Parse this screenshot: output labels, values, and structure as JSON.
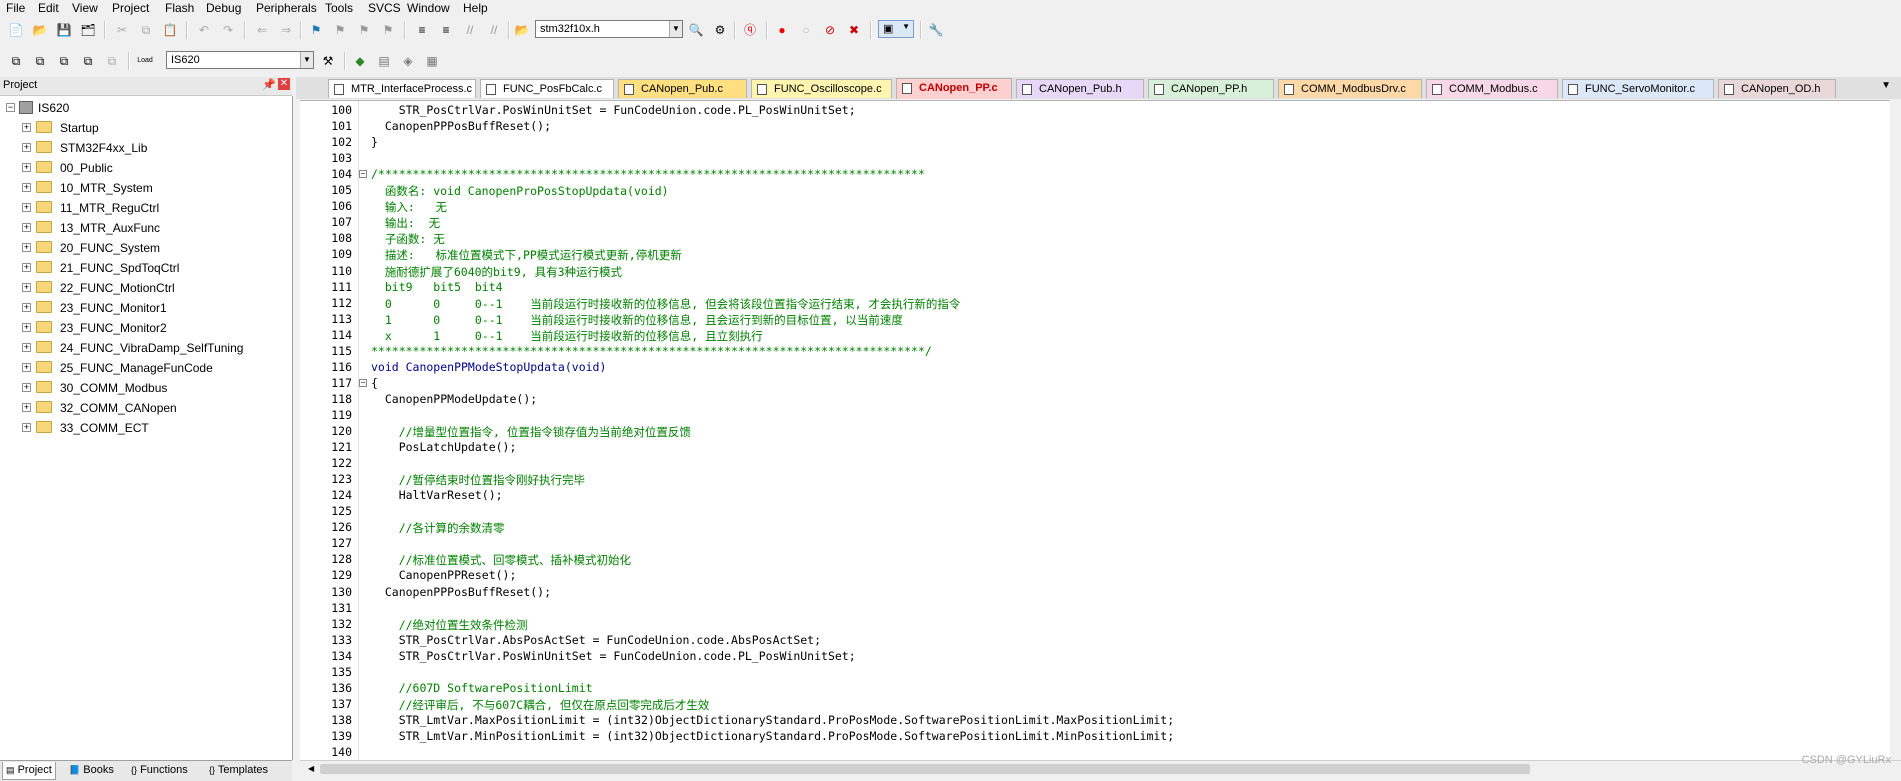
{
  "menu": [
    "File",
    "Edit",
    "View",
    "Project",
    "Flash",
    "Debug",
    "Peripherals",
    "Tools",
    "SVCS",
    "Window",
    "Help"
  ],
  "toolbar1": {
    "file_combo": "stm32f10x.h"
  },
  "toolbar2": {
    "target_combo": "IS620",
    "load_label": "Load"
  },
  "project": {
    "title": "Project",
    "root": "IS620",
    "items": [
      "Startup",
      "STM32F4xx_Lib",
      "00_Public",
      "10_MTR_System",
      "11_MTR_ReguCtrl",
      "13_MTR_AuxFunc",
      "20_FUNC_System",
      "21_FUNC_SpdToqCtrl",
      "22_FUNC_MotionCtrl",
      "23_FUNC_Monitor1",
      "23_FUNC_Monitor2",
      "24_FUNC_VibraDamp_SelfTuning",
      "25_FUNC_ManageFunCode",
      "30_COMM_Modbus",
      "32_COMM_CANopen",
      "33_COMM_ECT"
    ],
    "tabs": [
      "Project",
      "Books",
      "Functions",
      "Templates"
    ]
  },
  "tabs": [
    {
      "label": "MTR_InterfaceProcess.c",
      "color": "#ffffff"
    },
    {
      "label": "FUNC_PosFbCalc.c",
      "color": "#ffffff"
    },
    {
      "label": "CANopen_Pub.c",
      "color": "#ffe080"
    },
    {
      "label": "FUNC_Oscilloscope.c",
      "color": "#fff5b0"
    },
    {
      "label": "CANopen_PP.c",
      "color": "#ffd0d0"
    },
    {
      "label": "CANopen_Pub.h",
      "color": "#e8d8f8"
    },
    {
      "label": "CANopen_PP.h",
      "color": "#d8f0d8"
    },
    {
      "label": "COMM_ModbusDrv.c",
      "color": "#ffd8a8"
    },
    {
      "label": "COMM_Modbus.c",
      "color": "#f8d8e8"
    },
    {
      "label": "FUNC_ServoMonitor.c",
      "color": "#dce8f8"
    },
    {
      "label": "CANopen_OD.h",
      "color": "#e8d8d8"
    }
  ],
  "active_tab": "CANopen_PP.c",
  "code_lines": [
    {
      "n": "100",
      "t": "    STR_PosCtrlVar.PosWinUnitSet = FunCodeUnion.code.PL_PosWinUnitSet;",
      "c": false
    },
    {
      "n": "101",
      "t": "  CanopenPPPosBuffReset();",
      "c": false
    },
    {
      "n": "102",
      "t": "}",
      "c": false
    },
    {
      "n": "103",
      "t": "",
      "c": false
    },
    {
      "n": "104",
      "t": "/*******************************************************************************",
      "c": true
    },
    {
      "n": "105",
      "t": "  函数名: void CanopenProPosStopUpdata(void)",
      "c": true
    },
    {
      "n": "106",
      "t": "  输入:   无",
      "c": true
    },
    {
      "n": "107",
      "t": "  输出:  无",
      "c": true
    },
    {
      "n": "108",
      "t": "  子函数: 无",
      "c": true
    },
    {
      "n": "109",
      "t": "  描述:   标准位置模式下,PP模式运行模式更新,停机更新",
      "c": true
    },
    {
      "n": "110",
      "t": "  施耐德扩展了6040的bit9, 具有3种运行模式",
      "c": true
    },
    {
      "n": "111",
      "t": "  bit9   bit5  bit4",
      "c": true
    },
    {
      "n": "112",
      "t": "  0      0     0--1    当前段运行时接收新的位移信息, 但会将该段位置指令运行结束, 才会执行新的指令",
      "c": true
    },
    {
      "n": "113",
      "t": "  1      0     0--1    当前段运行时接收新的位移信息, 且会运行到新的目标位置, 以当前速度",
      "c": true
    },
    {
      "n": "114",
      "t": "  x      1     0--1    当前段运行时接收新的位移信息, 且立刻执行",
      "c": true
    },
    {
      "n": "115",
      "t": "********************************************************************************/",
      "c": true
    },
    {
      "n": "116",
      "t": "void CanopenPPModeStopUpdata(void)",
      "c": false,
      "kw": true
    },
    {
      "n": "117",
      "t": "{",
      "c": false
    },
    {
      "n": "118",
      "t": "  CanopenPPModeUpdate();",
      "c": false
    },
    {
      "n": "119",
      "t": "",
      "c": false
    },
    {
      "n": "120",
      "t": "    //增量型位置指令, 位置指令锁存值为当前绝对位置反馈",
      "c": true
    },
    {
      "n": "121",
      "t": "    PosLatchUpdate();",
      "c": false
    },
    {
      "n": "122",
      "t": "",
      "c": false
    },
    {
      "n": "123",
      "t": "    //暂停结束时位置指令刚好执行完毕",
      "c": true
    },
    {
      "n": "124",
      "t": "    HaltVarReset();",
      "c": false
    },
    {
      "n": "125",
      "t": "",
      "c": false
    },
    {
      "n": "126",
      "t": "    //各计算的余数清零",
      "c": true
    },
    {
      "n": "127",
      "t": "",
      "c": false
    },
    {
      "n": "128",
      "t": "    //标准位置模式、回零模式、插补模式初始化",
      "c": true
    },
    {
      "n": "129",
      "t": "    CanopenPPReset();",
      "c": false
    },
    {
      "n": "130",
      "t": "  CanopenPPPosBuffReset();",
      "c": false
    },
    {
      "n": "131",
      "t": "",
      "c": false
    },
    {
      "n": "132",
      "t": "    //绝对位置生效条件检测",
      "c": true
    },
    {
      "n": "133",
      "t": "    STR_PosCtrlVar.AbsPosActSet = FunCodeUnion.code.AbsPosActSet;",
      "c": false
    },
    {
      "n": "134",
      "t": "    STR_PosCtrlVar.PosWinUnitSet = FunCodeUnion.code.PL_PosWinUnitSet;",
      "c": false
    },
    {
      "n": "135",
      "t": "",
      "c": false
    },
    {
      "n": "136",
      "t": "    //607D SoftwarePositionLimit",
      "c": true
    },
    {
      "n": "137",
      "t": "    //经评审后, 不与607C耦合, 但仅在原点回零完成后才生效",
      "c": true
    },
    {
      "n": "138",
      "t": "    STR_LmtVar.MaxPositionLimit = (int32)ObjectDictionaryStandard.ProPosMode.SoftwarePositionLimit.MaxPositionLimit;",
      "c": false
    },
    {
      "n": "139",
      "t": "    STR_LmtVar.MinPositionLimit = (int32)ObjectDictionaryStandard.ProPosMode.SoftwarePositionLimit.MinPositionLimit;",
      "c": false
    },
    {
      "n": "140",
      "t": "",
      "c": false
    }
  ],
  "watermark": "CSDN @GYLiuRx"
}
